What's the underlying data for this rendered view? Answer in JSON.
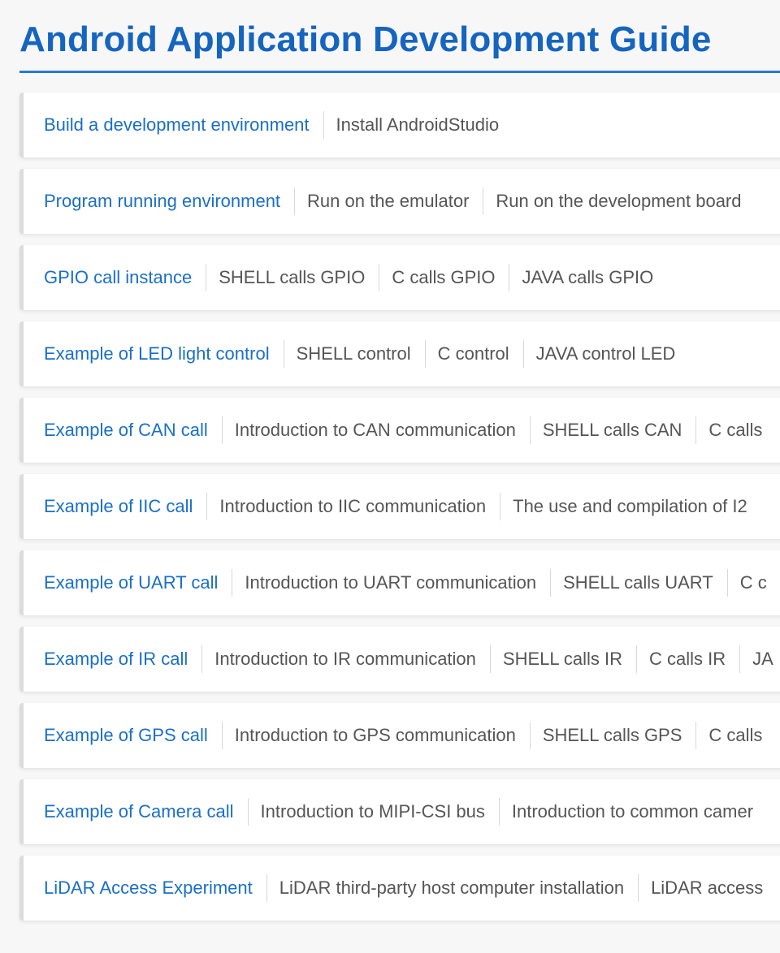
{
  "page": {
    "title": "Android Application Development Guide"
  },
  "colors": {
    "title": "#1565c0",
    "rule": "#2a79cf",
    "section_title": "#1a6fc7",
    "link_text": "#555555",
    "card_bg": "#ffffff",
    "page_bg": "#f7f7f7"
  },
  "sections": [
    {
      "title": "Build a development environment",
      "links": [
        "Install AndroidStudio"
      ]
    },
    {
      "title": "Program running environment",
      "links": [
        "Run on the emulator",
        "Run on the development board"
      ]
    },
    {
      "title": "GPIO call instance",
      "links": [
        "SHELL calls GPIO",
        "C calls GPIO",
        "JAVA calls GPIO"
      ]
    },
    {
      "title": "Example of LED light control",
      "links": [
        "SHELL control",
        "C control",
        "JAVA control LED"
      ]
    },
    {
      "title": "Example of CAN call",
      "links": [
        "Introduction to CAN communication",
        "SHELL calls CAN",
        "C calls"
      ]
    },
    {
      "title": "Example of IIC call",
      "links": [
        "Introduction to IIC communication",
        "The use and compilation of I2"
      ]
    },
    {
      "title": "Example of UART call",
      "links": [
        "Introduction to UART communication",
        "SHELL calls UART",
        "C c"
      ]
    },
    {
      "title": "Example of IR call",
      "links": [
        "Introduction to IR communication",
        "SHELL calls IR",
        "C calls IR",
        "JA"
      ]
    },
    {
      "title": "Example of GPS call",
      "links": [
        "Introduction to GPS communication",
        "SHELL calls GPS",
        "C calls"
      ]
    },
    {
      "title": "Example of Camera call",
      "links": [
        "Introduction to MIPI-CSI bus",
        "Introduction to common camer"
      ]
    },
    {
      "title": "LiDAR Access Experiment",
      "links": [
        "LiDAR third-party host computer installation",
        "LiDAR access"
      ]
    }
  ]
}
